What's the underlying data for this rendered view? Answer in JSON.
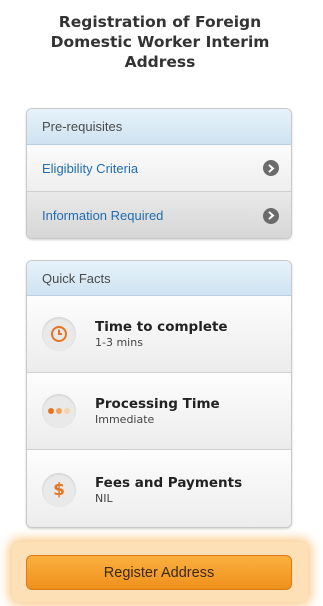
{
  "title": "Registration of Foreign Domestic Worker Interim Address",
  "prerequisites": {
    "header": "Pre-requisites",
    "items": [
      {
        "label": "Eligibility Criteria"
      },
      {
        "label": "Information Required"
      }
    ]
  },
  "quick_facts": {
    "header": "Quick Facts",
    "items": [
      {
        "title": "Time to complete",
        "subtitle": "1-3 mins",
        "icon": "clock-icon"
      },
      {
        "title": "Processing Time",
        "subtitle": "Immediate",
        "icon": "dots-icon"
      },
      {
        "title": "Fees and Payments",
        "subtitle": "NIL",
        "icon": "dollar-icon"
      }
    ]
  },
  "register_button": {
    "label": "Register Address"
  },
  "colors": {
    "accent_orange": "#e8731e",
    "link_blue": "#1f6db3",
    "button_orange": "#f5a12b"
  }
}
